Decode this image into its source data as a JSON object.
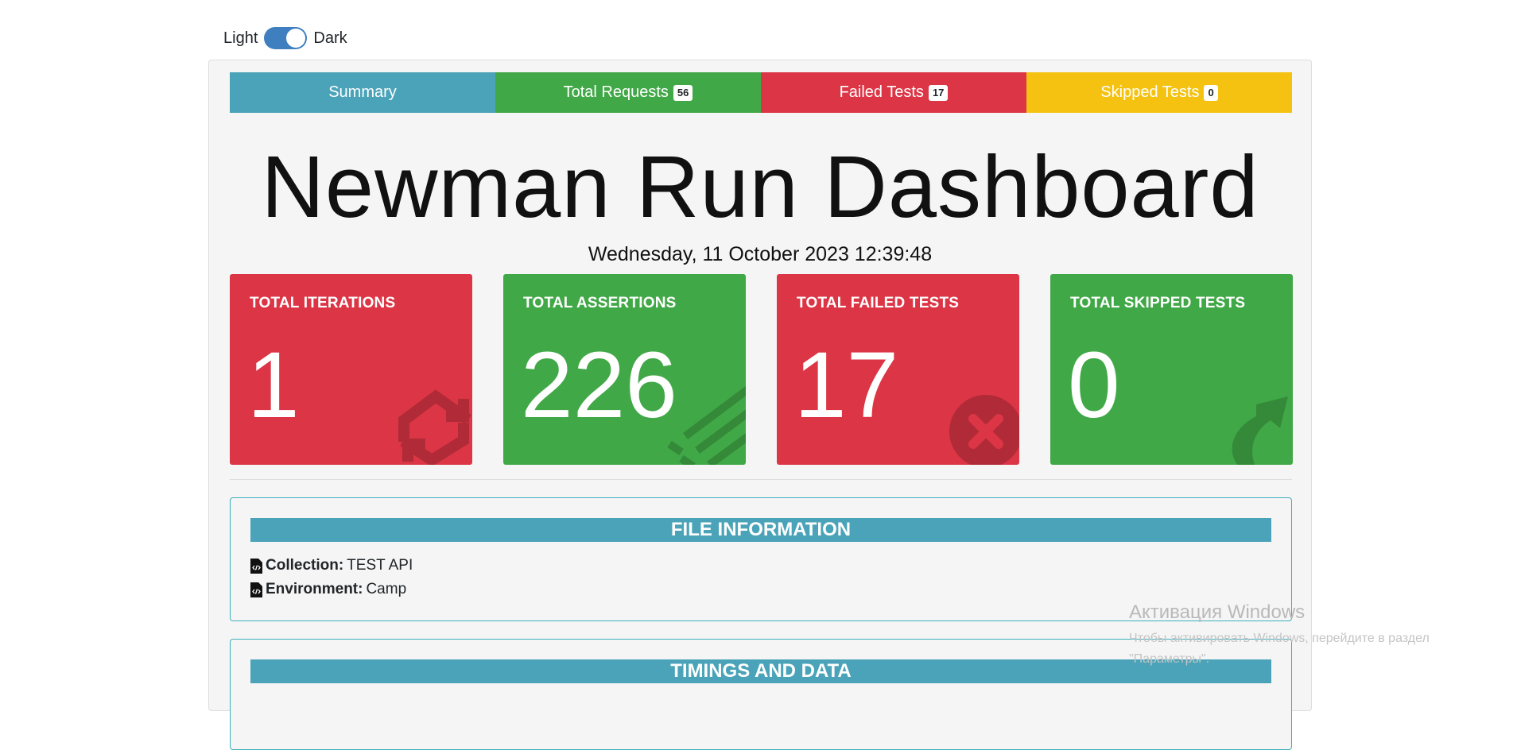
{
  "theme_toggle": {
    "light_label": "Light",
    "dark_label": "Dark",
    "state": "dark"
  },
  "tabs": [
    {
      "label": "Summary",
      "badge": ""
    },
    {
      "label": "Total Requests",
      "badge": "56"
    },
    {
      "label": "Failed Tests",
      "badge": "17"
    },
    {
      "label": "Skipped Tests",
      "badge": "0"
    }
  ],
  "title": "Newman Run Dashboard",
  "date": "Wednesday, 11 October 2023 12:39:48",
  "cards": [
    {
      "label": "TOTAL ITERATIONS",
      "value": "1",
      "color": "#dc3545",
      "icon": "sync-icon"
    },
    {
      "label": "TOTAL ASSERTIONS",
      "value": "226",
      "color": "#41a847",
      "icon": "assertions-icon"
    },
    {
      "label": "TOTAL FAILED TESTS",
      "value": "17",
      "color": "#dc3545",
      "icon": "times-circle-icon"
    },
    {
      "label": "TOTAL SKIPPED TESTS",
      "value": "0",
      "color": "#41a847",
      "icon": "share-arrow-icon"
    }
  ],
  "file_information": {
    "header": "FILE INFORMATION",
    "collection_label": "Collection:",
    "collection_value": "TEST API",
    "environment_label": "Environment:",
    "environment_value": "Camp"
  },
  "timings": {
    "header": "TIMINGS AND DATA"
  },
  "watermark": {
    "title": "Активация Windows",
    "line1": "Чтобы активировать Windows, перейдите в раздел",
    "line2": "\"Параметры\"."
  },
  "colors": {
    "summary": "#4aa3b8",
    "success": "#41a847",
    "danger": "#dc3545",
    "warning": "#f5c211",
    "panel_border": "#3fb0bd"
  }
}
